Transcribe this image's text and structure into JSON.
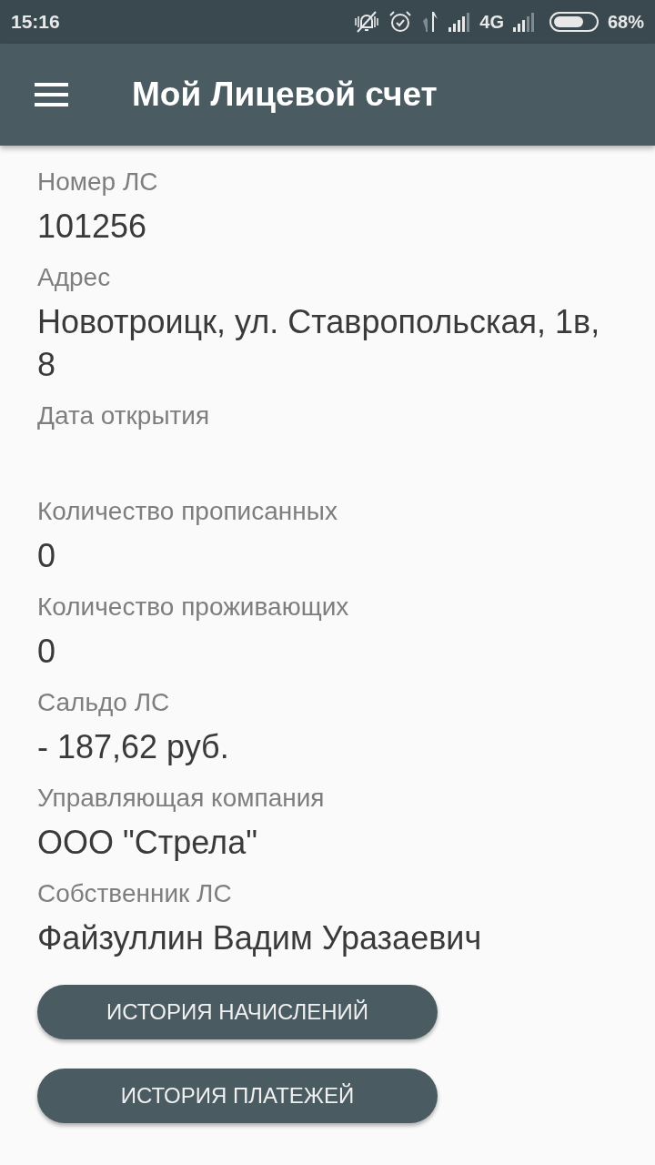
{
  "status_bar": {
    "time": "15:16",
    "network": "4G",
    "battery": "68%"
  },
  "app_bar": {
    "title": "Мой Лицевой счет"
  },
  "fields": [
    {
      "label": "Номер ЛС",
      "value": "101256"
    },
    {
      "label": "Адрес",
      "value": "Новотроицк, ул. Ставропольская, 1в, 8"
    },
    {
      "label": "Дата открытия"
    },
    {
      "label": "Количество прописанных",
      "value": "0"
    },
    {
      "label": "Количество проживающих",
      "value": "0"
    },
    {
      "label": "Сальдо ЛС",
      "value": "- 187,62 руб."
    },
    {
      "label": "Управляющая компания",
      "value": "ООО \"Стрела\""
    },
    {
      "label": "Собственник ЛС",
      "value": "Файзуллин Вадим Уразаевич"
    }
  ],
  "buttons": [
    "ИСТОРИЯ НАЧИСЛЕНИЙ",
    "ИСТОРИЯ ПЛАТЕЖЕЙ"
  ]
}
